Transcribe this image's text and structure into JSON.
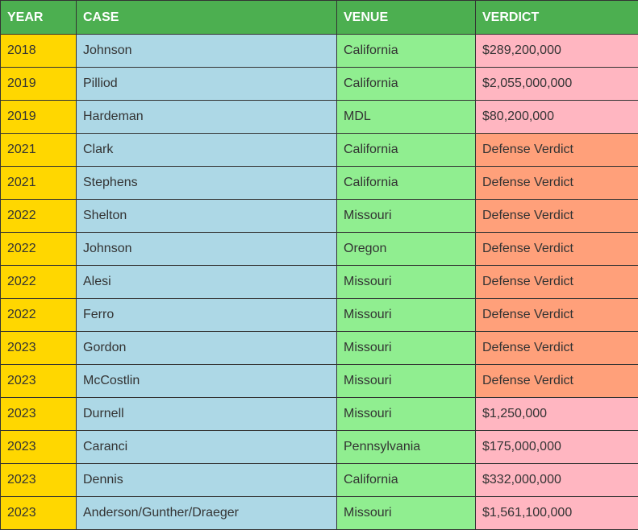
{
  "colors": {
    "header_bg": "#4caf50",
    "header_text": "#ffffff",
    "year_bg": "#ffd700",
    "case_bg": "#add8e6",
    "venue_bg": "#90ee90",
    "verdict_amount_bg": "#ffb6c1",
    "verdict_defense_bg": "#ffa07a"
  },
  "table": {
    "headers": {
      "year": "YEAR",
      "case": "CASE",
      "venue": "VENUE",
      "verdict": "VERDICT"
    },
    "rows": [
      {
        "year": "2018",
        "case": "Johnson",
        "venue": "California",
        "verdict": "$289,200,000"
      },
      {
        "year": "2019",
        "case": "Pilliod",
        "venue": "California",
        "verdict": "$2,055,000,000"
      },
      {
        "year": "2019",
        "case": "Hardeman",
        "venue": "MDL",
        "verdict": "$80,200,000"
      },
      {
        "year": "2021",
        "case": "Clark",
        "venue": "California",
        "verdict": "Defense Verdict"
      },
      {
        "year": "2021",
        "case": "Stephens",
        "venue": "California",
        "verdict": "Defense Verdict"
      },
      {
        "year": "2022",
        "case": "Shelton",
        "venue": "Missouri",
        "verdict": "Defense Verdict"
      },
      {
        "year": "2022",
        "case": "Johnson",
        "venue": "Oregon",
        "verdict": "Defense Verdict"
      },
      {
        "year": "2022",
        "case": "Alesi",
        "venue": "Missouri",
        "verdict": "Defense Verdict"
      },
      {
        "year": "2022",
        "case": "Ferro",
        "venue": "Missouri",
        "verdict": "Defense Verdict"
      },
      {
        "year": "2023",
        "case": "Gordon",
        "venue": "Missouri",
        "verdict": "Defense Verdict"
      },
      {
        "year": "2023",
        "case": "McCostlin",
        "venue": "Missouri",
        "verdict": "Defense Verdict"
      },
      {
        "year": "2023",
        "case": "Durnell",
        "venue": "Missouri",
        "verdict": "$1,250,000"
      },
      {
        "year": "2023",
        "case": "Caranci",
        "venue": "Pennsylvania",
        "verdict": "$175,000,000"
      },
      {
        "year": "2023",
        "case": "Dennis",
        "venue": "California",
        "verdict": "$332,000,000"
      },
      {
        "year": "2023",
        "case": "Anderson/Gunther/Draeger",
        "venue": "Missouri",
        "verdict": "$1,561,100,000"
      }
    ]
  }
}
